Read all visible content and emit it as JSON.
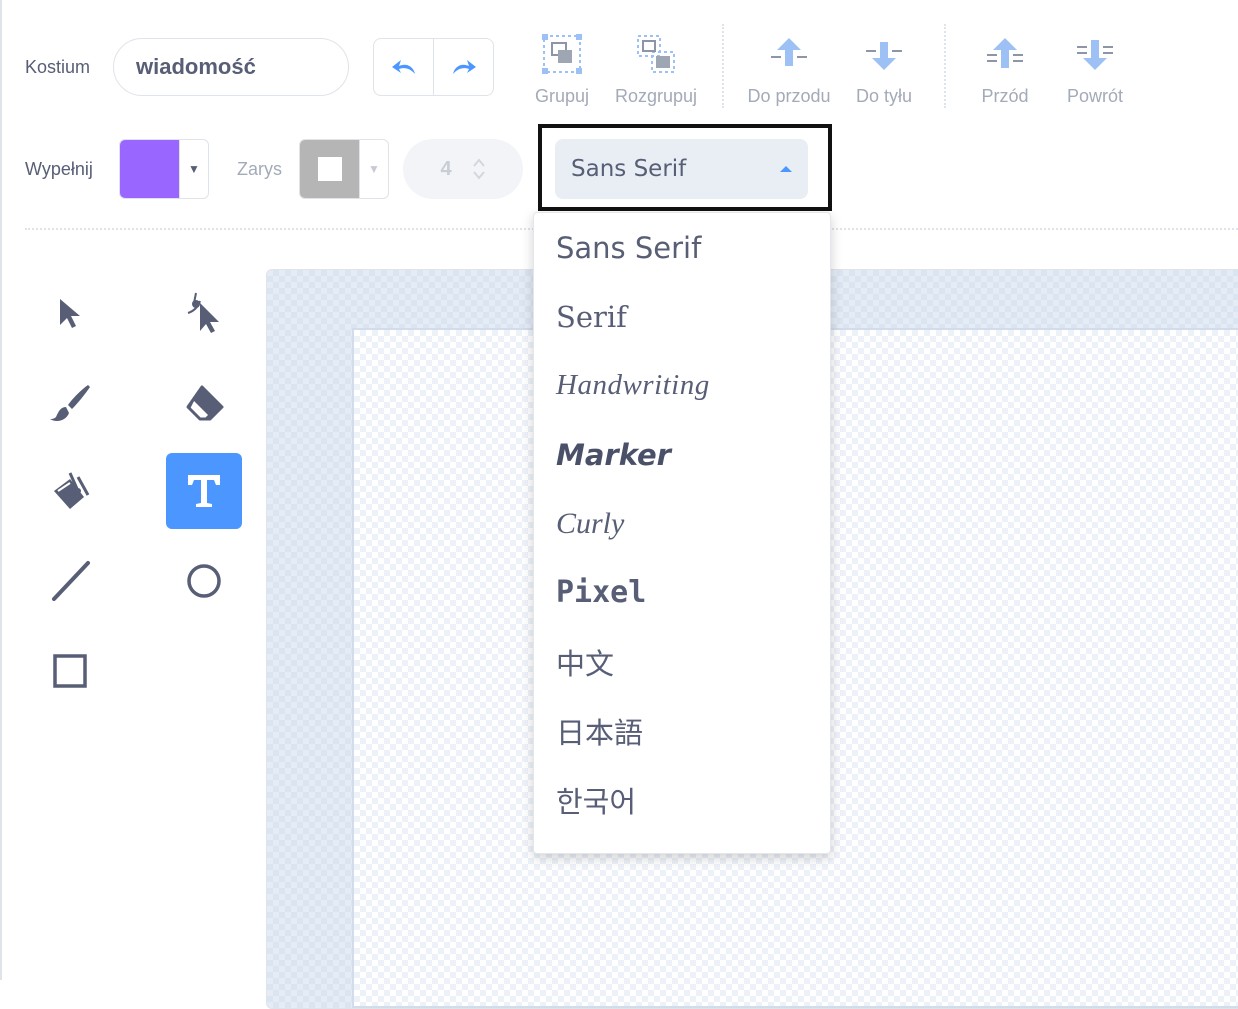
{
  "header": {
    "costume_label": "Kostium",
    "costume_name": "wiadomość",
    "undo_icon": "undo-icon",
    "redo_icon": "redo-icon",
    "group_label": "Grupuj",
    "ungroup_label": "Rozgrupuj",
    "forward_label": "Do przodu",
    "backward_label": "Do tyłu",
    "front_label": "Przód",
    "back_label": "Powrót"
  },
  "style_bar": {
    "fill_label": "Wypełnij",
    "fill_color": "#9966ff",
    "outline_label": "Zarys",
    "outline_color": "#b5b5b5",
    "outline_width": "4",
    "font_selected": "Sans Serif"
  },
  "font_menu": {
    "items": [
      "Sans Serif",
      "Serif",
      "Handwriting",
      "Marker",
      "Curly",
      "Pixel",
      "中文",
      "日本語",
      "한국어"
    ]
  },
  "tools": [
    {
      "name": "select",
      "icon": "arrow-cursor-icon"
    },
    {
      "name": "reshape",
      "icon": "reshape-cursor-icon"
    },
    {
      "name": "brush",
      "icon": "brush-icon"
    },
    {
      "name": "eraser",
      "icon": "eraser-icon"
    },
    {
      "name": "fill",
      "icon": "paint-bucket-icon"
    },
    {
      "name": "text",
      "icon": "text-t-icon",
      "active": true
    },
    {
      "name": "line",
      "icon": "line-icon"
    },
    {
      "name": "circle",
      "icon": "circle-icon"
    },
    {
      "name": "rectangle",
      "icon": "rectangle-icon"
    }
  ],
  "colors": {
    "accent": "#4c97ff",
    "text": "#575e75",
    "muted": "#a3aab8",
    "icon_light_blue": "#9ec1f5"
  }
}
